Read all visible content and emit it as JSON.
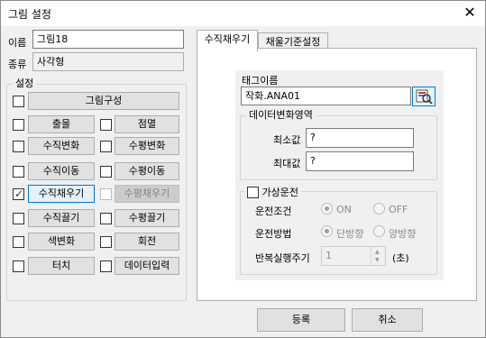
{
  "window": {
    "title": "그림 설정",
    "close_glyph": "✕"
  },
  "left": {
    "name_label": "이름",
    "name_value": "그림18",
    "type_label": "종류",
    "type_value": "사각형",
    "settings_group_label": "설정",
    "compose_button": "그림구성",
    "options": [
      {
        "label": "출몰",
        "checked": false,
        "disabled": false
      },
      {
        "label": "점멸",
        "checked": false,
        "disabled": false
      },
      {
        "label": "수직변화",
        "checked": false,
        "disabled": false
      },
      {
        "label": "수평변화",
        "checked": false,
        "disabled": false
      },
      {
        "label": "수직이동",
        "checked": false,
        "disabled": false
      },
      {
        "label": "수평이동",
        "checked": false,
        "disabled": false
      },
      {
        "label": "수직채우기",
        "checked": true,
        "disabled": false
      },
      {
        "label": "수평채우기",
        "checked": false,
        "disabled": true
      },
      {
        "label": "수직끌기",
        "checked": false,
        "disabled": false
      },
      {
        "label": "수평끌기",
        "checked": false,
        "disabled": false
      },
      {
        "label": "색변화",
        "checked": false,
        "disabled": false
      },
      {
        "label": "회전",
        "checked": false,
        "disabled": false
      },
      {
        "label": "터치",
        "checked": false,
        "disabled": false
      },
      {
        "label": "데이터입력",
        "checked": false,
        "disabled": false
      }
    ]
  },
  "tabs": [
    {
      "label": "수직채우기",
      "active": true
    },
    {
      "label": "채울기준설정",
      "active": false
    }
  ],
  "panel": {
    "tag_label": "태그이름",
    "tag_value": "작화.ANA01",
    "data_range_group": "데이터변화영역",
    "min_label": "최소값",
    "min_value": "?",
    "max_label": "최대값",
    "max_value": "?",
    "virtual_op_label": "가상운전",
    "op_condition_label": "운전조건",
    "on_label": "ON",
    "off_label": "OFF",
    "op_method_label": "운전방법",
    "one_way_label": "단방향",
    "two_way_label": "양방향",
    "repeat_period_label": "반복실행주기",
    "repeat_period_value": "1",
    "unit_label": "(초)"
  },
  "footer": {
    "ok_label": "등록",
    "cancel_label": "취소"
  },
  "colors": {
    "accent": "#0078d7",
    "selected_button": "#e5f1fb"
  }
}
